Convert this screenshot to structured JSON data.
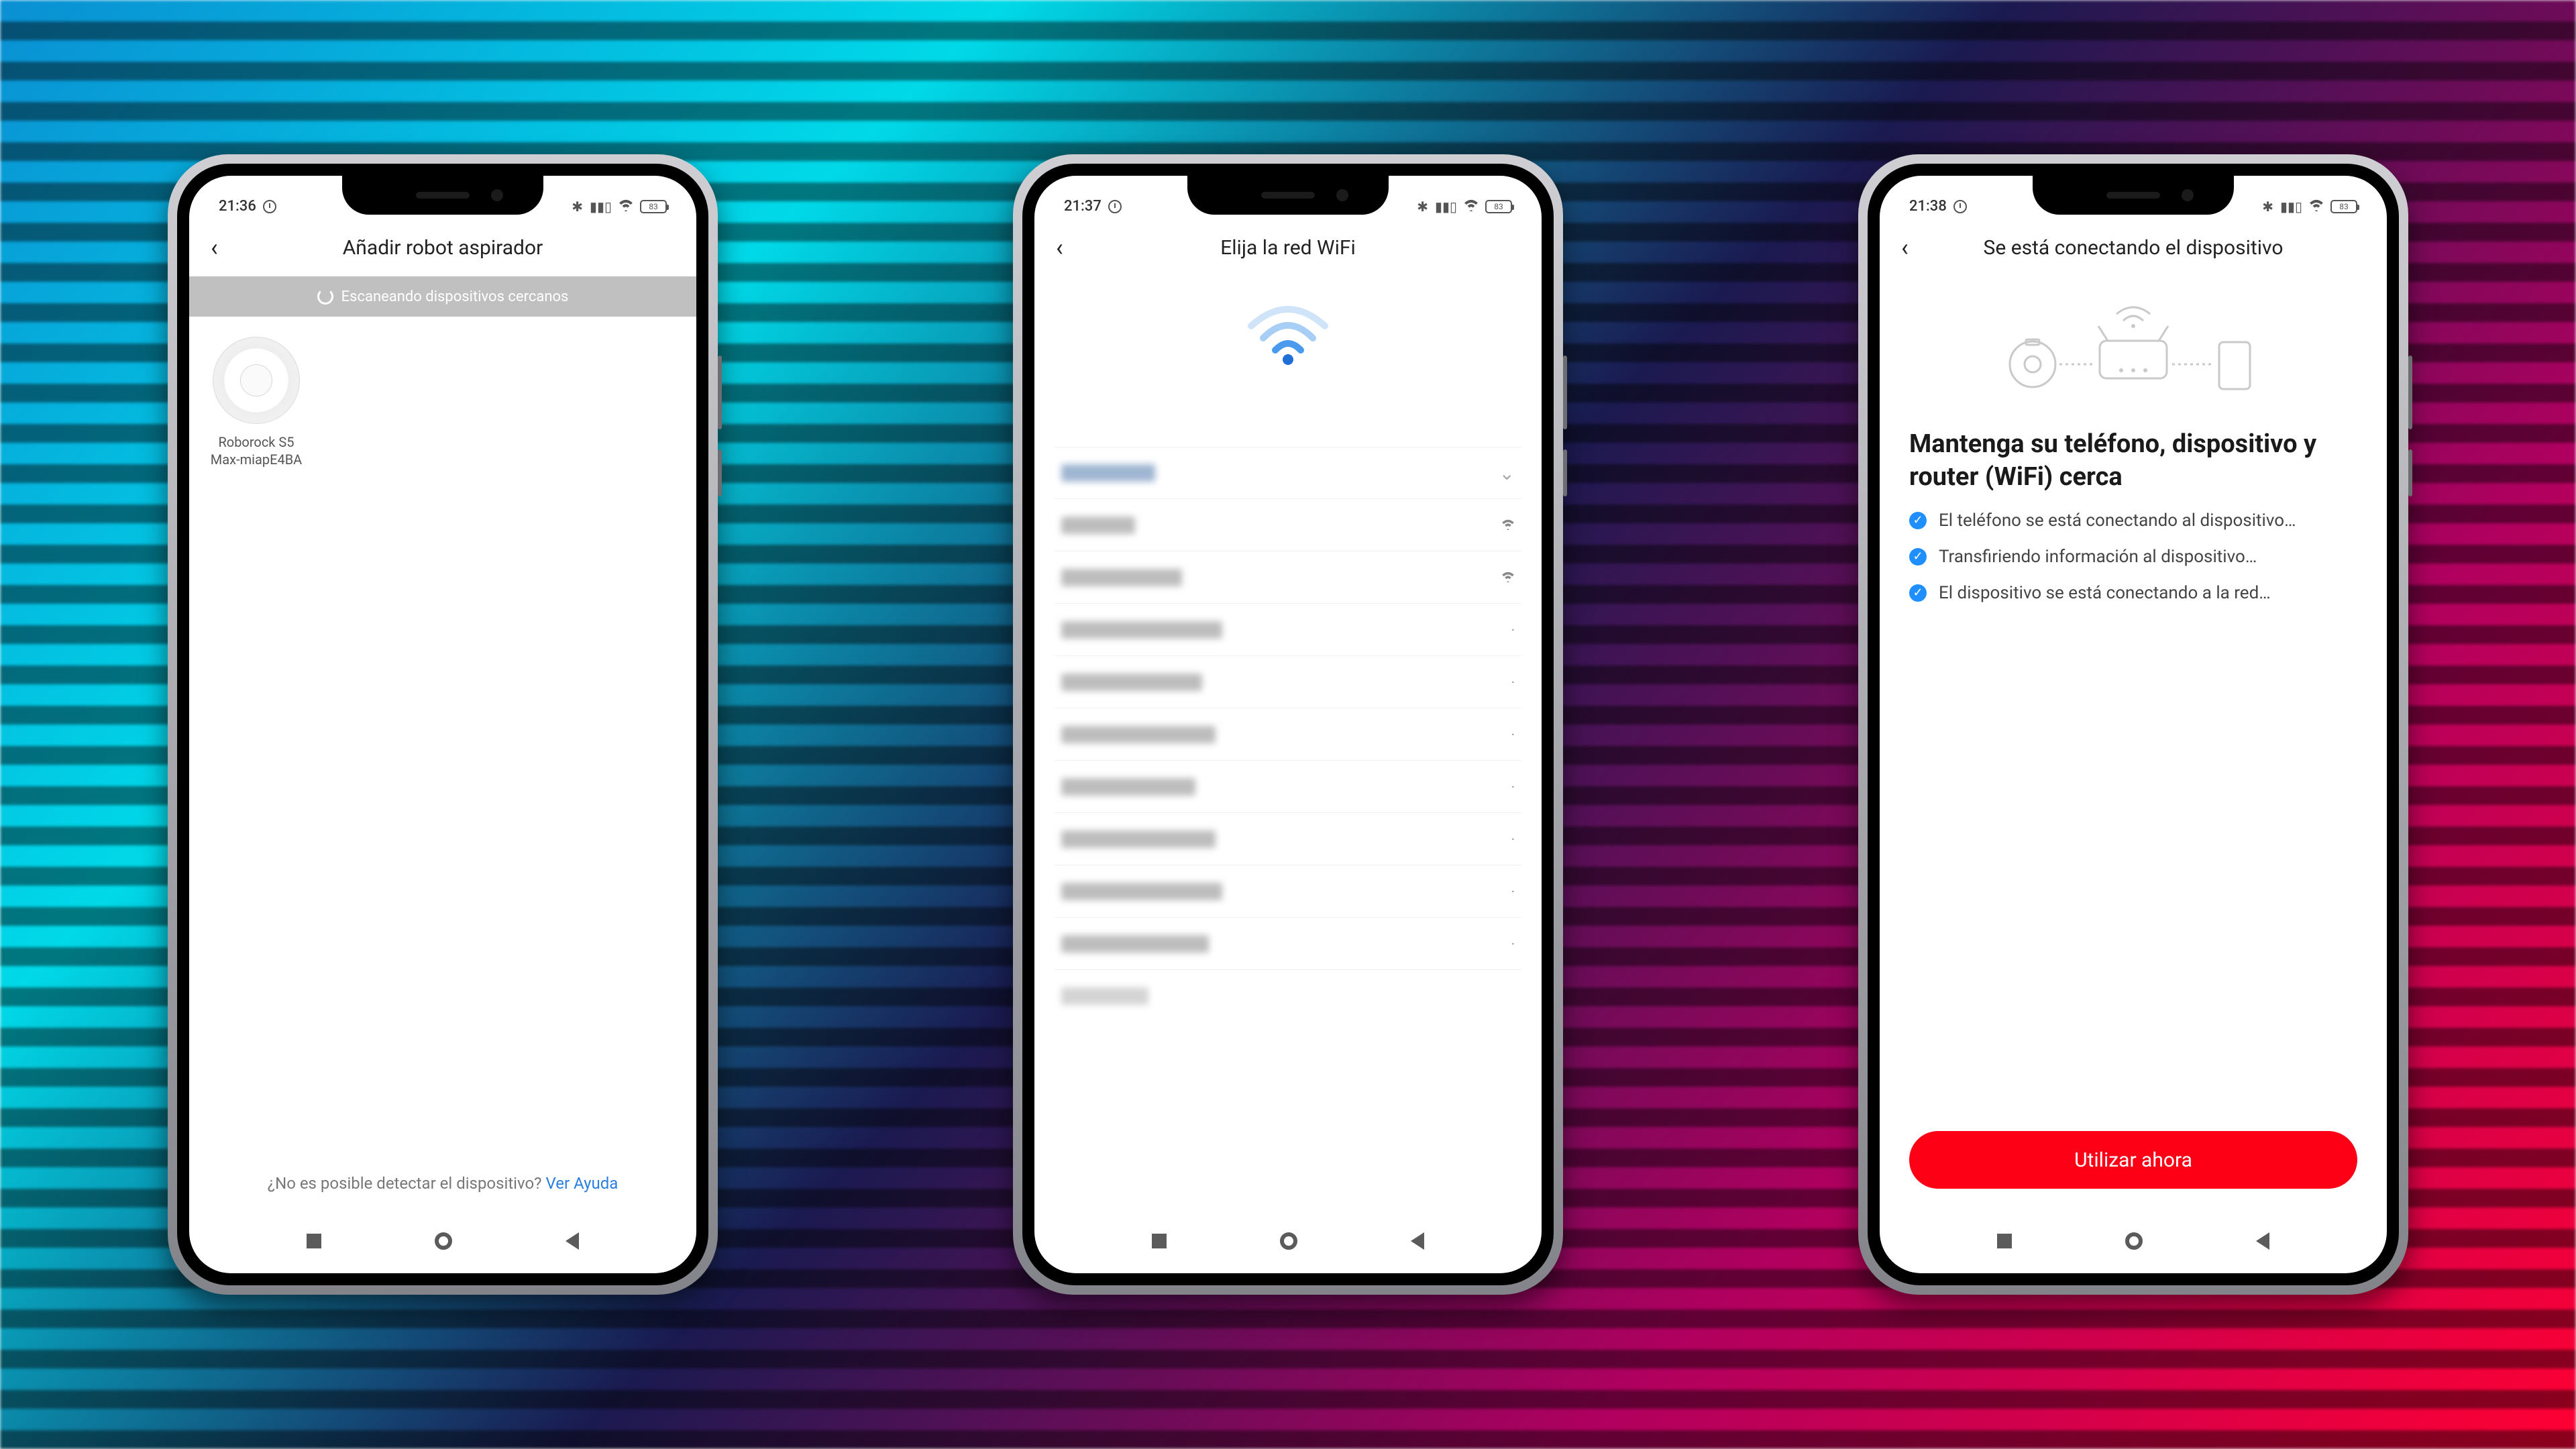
{
  "screens": {
    "s1": {
      "time": "21:36",
      "battery": "83",
      "title": "Añadir robot aspirador",
      "scanning": "Escaneando dispositivos cercanos",
      "device_line1": "Roborock S5",
      "device_line2": "Max-miapE4BA",
      "help_q": "¿No es posible detectar el dispositivo? ",
      "help_link": "Ver Ayuda"
    },
    "s2": {
      "time": "21:37",
      "battery": "83",
      "title": "Elija la red WiFi"
    },
    "s3": {
      "time": "21:38",
      "battery": "83",
      "title": "Se está conectando el dispositivo",
      "heading": "Mantenga su teléfono, dispositivo y router (WiFi) cerca",
      "step1": "El teléfono se está conectando al dispositivo…",
      "step2": "Transfiriendo información al dispositivo…",
      "step3": "El dispositivo se está conectando a la red…",
      "cta": "Utilizar ahora"
    }
  },
  "colors": {
    "accent_red": "#fd0016",
    "link_blue": "#2a7fe0",
    "check_blue": "#1f8fff"
  }
}
